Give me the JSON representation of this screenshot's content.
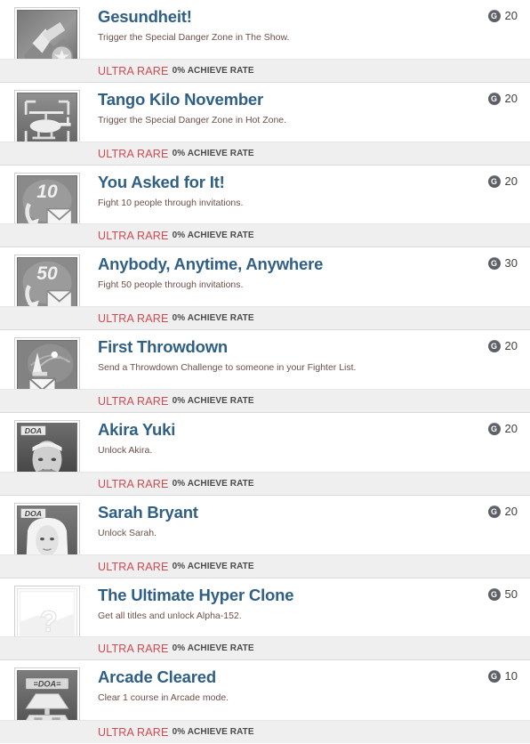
{
  "list": {
    "rarity_color": "#cd4b52",
    "title_color": "#2f5f85",
    "description_color": "#6d4f49",
    "badge_color": "#5d5f66",
    "score_icon": "gamerscore-g-icon",
    "achievements": [
      {
        "title": "Gesundheit!",
        "description": "Trigger the Special Danger Zone in The Show.",
        "score": "20",
        "score_letter": "G",
        "rarity": "ULTRA RARE",
        "rate": "0% ACHIEVE RATE",
        "icon_name": "gesundheit-thumbnail",
        "icon_style": "photo"
      },
      {
        "title": "Tango Kilo November",
        "description": "Trigger the Special Danger Zone in Hot Zone.",
        "score": "20",
        "score_letter": "G",
        "rarity": "ULTRA RARE",
        "rate": "0% ACHIEVE RATE",
        "icon_name": "tango-kilo-november-thumbnail",
        "icon_style": "helicopter"
      },
      {
        "title": "You Asked for It!",
        "description": "Fight 10 people through invitations.",
        "score": "20",
        "score_letter": "G",
        "rarity": "ULTRA RARE",
        "rate": "0% ACHIEVE RATE",
        "icon_name": "you-asked-for-it-thumbnail",
        "icon_style": "envelope-10"
      },
      {
        "title": "Anybody, Anytime, Anywhere",
        "description": "Fight 50 people through invitations.",
        "score": "30",
        "score_letter": "G",
        "rarity": "ULTRA RARE",
        "rate": "0% ACHIEVE RATE",
        "icon_name": "anybody-anytime-anywhere-thumbnail",
        "icon_style": "envelope-50"
      },
      {
        "title": "First Throwdown",
        "description": "Send a Throwdown Challenge to someone in your Fighter List.",
        "score": "20",
        "score_letter": "G",
        "rarity": "ULTRA RARE",
        "rate": "0% ACHIEVE RATE",
        "icon_name": "first-throwdown-thumbnail",
        "icon_style": "envelope-1"
      },
      {
        "title": "Akira Yuki",
        "description": "Unlock Akira.",
        "score": "20",
        "score_letter": "G",
        "rarity": "ULTRA RARE",
        "rate": "0% ACHIEVE RATE",
        "icon_name": "akira-yuki-thumbnail",
        "icon_style": "portrait-dark"
      },
      {
        "title": "Sarah Bryant",
        "description": "Unlock Sarah.",
        "score": "20",
        "score_letter": "G",
        "rarity": "ULTRA RARE",
        "rate": "0% ACHIEVE RATE",
        "icon_name": "sarah-bryant-thumbnail",
        "icon_style": "portrait-light"
      },
      {
        "title": "The Ultimate Hyper Clone",
        "description": "Get all titles and unlock Alpha-152.",
        "score": "50",
        "score_letter": "G",
        "rarity": "ULTRA RARE",
        "rate": "0% ACHIEVE RATE",
        "icon_name": "ultimate-hyper-clone-thumbnail",
        "icon_style": "question-placeholder"
      },
      {
        "title": "Arcade Cleared",
        "description": "Clear 1 course in Arcade mode.",
        "score": "10",
        "score_letter": "G",
        "rarity": "ULTRA RARE",
        "rate": "0% ACHIEVE RATE",
        "icon_name": "arcade-cleared-thumbnail",
        "icon_style": "arcade-stage"
      }
    ]
  }
}
